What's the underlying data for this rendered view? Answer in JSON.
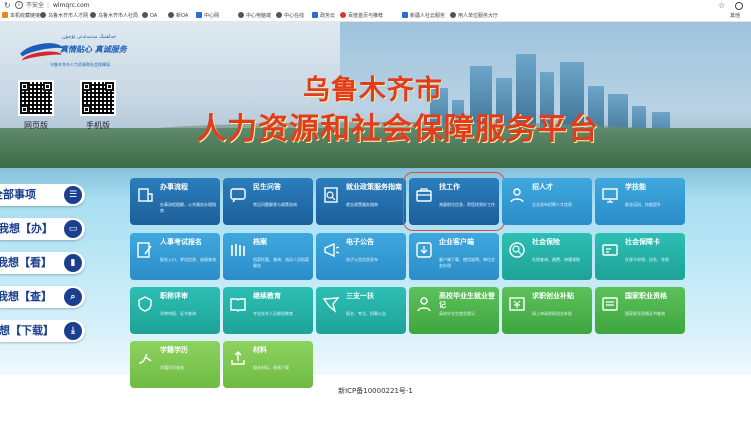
{
  "browser": {
    "insecure_label": "不安全",
    "url": "wlmqrc.com",
    "bookmarks": [
      {
        "label": "本机收藏链接",
        "icon": "folder-icon"
      },
      {
        "label": "乌鲁木齐市人才网",
        "icon": "globe-icon"
      },
      {
        "label": "乌鲁木齐市人社局",
        "icon": "globe-icon"
      },
      {
        "label": "OA",
        "icon": "globe-icon"
      },
      {
        "label": "新OA",
        "icon": "globe-icon"
      },
      {
        "label": "中心网",
        "icon": "doc-icon"
      },
      {
        "label": "中心电脑端",
        "icon": "globe-icon"
      },
      {
        "label": "中心在线",
        "icon": "globe-icon"
      },
      {
        "label": "政务云",
        "icon": "doc-icon"
      },
      {
        "label": "百度首页与推荐",
        "icon": "red-icon"
      },
      {
        "label": "新疆人社云服务",
        "icon": "doc-icon"
      },
      {
        "label": "用人单位服务大厅",
        "icon": "globe-icon"
      }
    ],
    "bookmarks_end": "其他"
  },
  "hero": {
    "logo_uyghur": "خەلقنىڭ مەنپەئەتى ئۈچۈن",
    "logo_slogan": "真情贴心 真诚服务",
    "logo_sub": "乌鲁木齐市人力资源和社会保障局",
    "qr_web_label": "网页版",
    "qr_mobile_label": "手机版",
    "title_line1": "乌鲁木齐市",
    "title_line2": "人力资源和社会保障服务平台"
  },
  "sidebar": [
    {
      "label": "全部事项",
      "icon": "menu-icon",
      "glyph": "☰"
    },
    {
      "label": "我想【办】",
      "icon": "monitor-icon",
      "glyph": "▭"
    },
    {
      "label": "我想【看】",
      "icon": "book-icon",
      "glyph": "▮"
    },
    {
      "label": "我想【查】",
      "icon": "search-icon",
      "glyph": "⌕"
    },
    {
      "label": "我想【下载】",
      "icon": "download-icon",
      "glyph": "⤓"
    }
  ],
  "tiles": [
    {
      "name": "办事流程",
      "desc": "办事流程图解，公共服务办理指南",
      "color": "dark",
      "icon": "building-icon"
    },
    {
      "name": "民生问答",
      "desc": "常见问题解答与政策咨询",
      "color": "dark",
      "icon": "chat-icon"
    },
    {
      "name": "就业政策服务指南",
      "desc": "就业政策服务指南",
      "color": "dark",
      "icon": "search-doc-icon"
    },
    {
      "name": "找工作",
      "desc": "海量职位信息，帮您找到好工作",
      "color": "dark",
      "icon": "briefcase-icon"
    },
    {
      "name": "招人才",
      "desc": "企业发布招聘人才信息",
      "color": "sky",
      "icon": "person-icon"
    },
    {
      "name": "学技能",
      "desc": "职业培训、技能提升",
      "color": "sky",
      "icon": "screen-icon"
    },
    {
      "name": "人事考试报名",
      "desc": "报名入口、考试信息、成绩查询",
      "color": "sky",
      "icon": "pencil-icon"
    },
    {
      "name": "档案",
      "desc": "档案托管、查询、流动人员档案服务",
      "color": "sky",
      "icon": "files-icon"
    },
    {
      "name": "电子公告",
      "desc": "电子公告信息发布",
      "color": "sky",
      "icon": "megaphone-icon"
    },
    {
      "name": "企业客户端",
      "desc": "客户端下载、使用说明、单位业务办理",
      "color": "sky",
      "icon": "download-box-icon"
    },
    {
      "name": "社会保险",
      "desc": "社保查询、缴费、待遇领取",
      "color": "teal",
      "icon": "search-circle-icon"
    },
    {
      "name": "社会保障卡",
      "desc": "社保卡申领、挂失、补换",
      "color": "teal",
      "icon": "card-icon"
    },
    {
      "name": "职称评审",
      "desc": "评审申报、证书查询",
      "color": "teal",
      "icon": "shield-icon"
    },
    {
      "name": "继续教育",
      "desc": "专业技术人员继续教育",
      "color": "teal",
      "icon": "open-book-icon"
    },
    {
      "name": "三支一扶",
      "desc": "报名、考试、招募公告",
      "color": "teal",
      "icon": "flag-icon"
    },
    {
      "name": "高校毕业生就业登记",
      "desc": "高校毕业生就业登记",
      "color": "green",
      "icon": "graduate-icon"
    },
    {
      "name": "求职创业补贴",
      "desc": "网上申请求职创业补贴",
      "color": "green",
      "icon": "money-icon"
    },
    {
      "name": "国家职业资格",
      "desc": "国家职业资格证书查询",
      "color": "green",
      "icon": "certificate-icon"
    },
    {
      "name": "学籍学历",
      "desc": "学籍学历查询",
      "color": "lime",
      "icon": "hand-icon"
    },
    {
      "name": "材料",
      "desc": "相关材料、表格下载",
      "color": "lime",
      "icon": "upload-icon"
    }
  ],
  "footer": {
    "icp": "新ICP备10000221号-1"
  }
}
